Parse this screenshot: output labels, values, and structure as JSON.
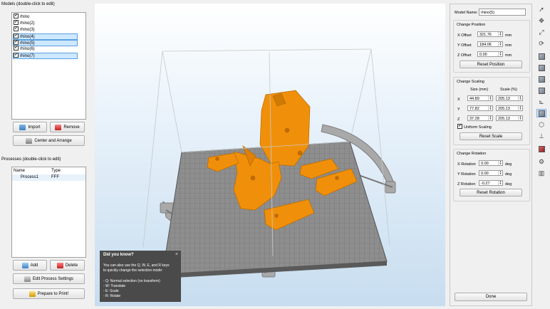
{
  "models_panel": {
    "title": "Models (double-click to edit)",
    "items": [
      {
        "label": "rhino",
        "checked": true,
        "selected": false
      },
      {
        "label": "rhino(2)",
        "checked": true,
        "selected": false
      },
      {
        "label": "rhino(3)",
        "checked": true,
        "selected": false
      },
      {
        "label": "rhino(4)",
        "checked": true,
        "selected": true
      },
      {
        "label": "rhino(5)",
        "checked": true,
        "selected": true
      },
      {
        "label": "rhino(6)",
        "checked": true,
        "selected": false
      },
      {
        "label": "rhino(7)",
        "checked": true,
        "selected": true
      }
    ],
    "import_label": "Import",
    "remove_label": "Remove",
    "center_label": "Center and Arrange"
  },
  "processes_panel": {
    "title": "Processes (double-click to edit)",
    "col_name": "Name",
    "col_type": "Type",
    "rows": [
      {
        "name": "Process1",
        "type": "FFF"
      }
    ],
    "add_label": "Add",
    "delete_label": "Delete",
    "edit_label": "Edit Process Settings",
    "prepare_label": "Prepare to Print!"
  },
  "tip": {
    "title": "Did you know?",
    "close": "×",
    "lines": [
      "You can also use the Q, W, E, and R keys",
      "to quickly change the selection mode:",
      "",
      "- Q: Normal selection (no transform)",
      "- W: Translate",
      "- E: Scale",
      "- R: Rotate"
    ]
  },
  "properties": {
    "model_name_label": "Model Name:",
    "model_name_value": "rhino(5)",
    "position": {
      "title": "Change Position",
      "x_label": "X Offset",
      "x_value": "321.76",
      "y_label": "Y Offset",
      "y_value": "184.06",
      "z_label": "Z Offset",
      "z_value": "0.00",
      "unit": "mm",
      "reset_label": "Reset Position"
    },
    "scaling": {
      "title": "Change Scaling",
      "size_header": "Size (mm)",
      "scale_header": "Scale (%)",
      "rows": [
        {
          "axis": "X",
          "size": "44.89",
          "scale": "205.13"
        },
        {
          "axis": "Y",
          "size": "77.82",
          "scale": "205.13"
        },
        {
          "axis": "Z",
          "size": "37.28",
          "scale": "205.13"
        }
      ],
      "uniform_label": "Uniform Scaling",
      "uniform_checked": true,
      "reset_label": "Reset Scale"
    },
    "rotation": {
      "title": "Change Rotation",
      "x_label": "X Rotation",
      "x_value": "0.00",
      "y_label": "Y Rotation",
      "y_value": "0.00",
      "z_label": "Z Rotation",
      "z_value": "-0.27",
      "unit": "deg",
      "reset_label": "Reset Rotation"
    },
    "done_label": "Done"
  },
  "toolbar": {
    "icons": [
      "cursor-icon",
      "move-icon",
      "scale-icon",
      "rotate-icon",
      "view-iso-icon",
      "view-front-icon",
      "view-left-icon",
      "view-right-icon",
      "view-top-icon",
      "axes-icon",
      "solid-view-icon",
      "wireframe-icon",
      "z-axis-icon",
      "model-icon",
      "settings-gear-icon",
      "library-icon"
    ]
  },
  "colors": {
    "model_orange": "#f0900a",
    "plate_grey": "#8c8c8c",
    "accent_blue": "#cde8ff"
  }
}
